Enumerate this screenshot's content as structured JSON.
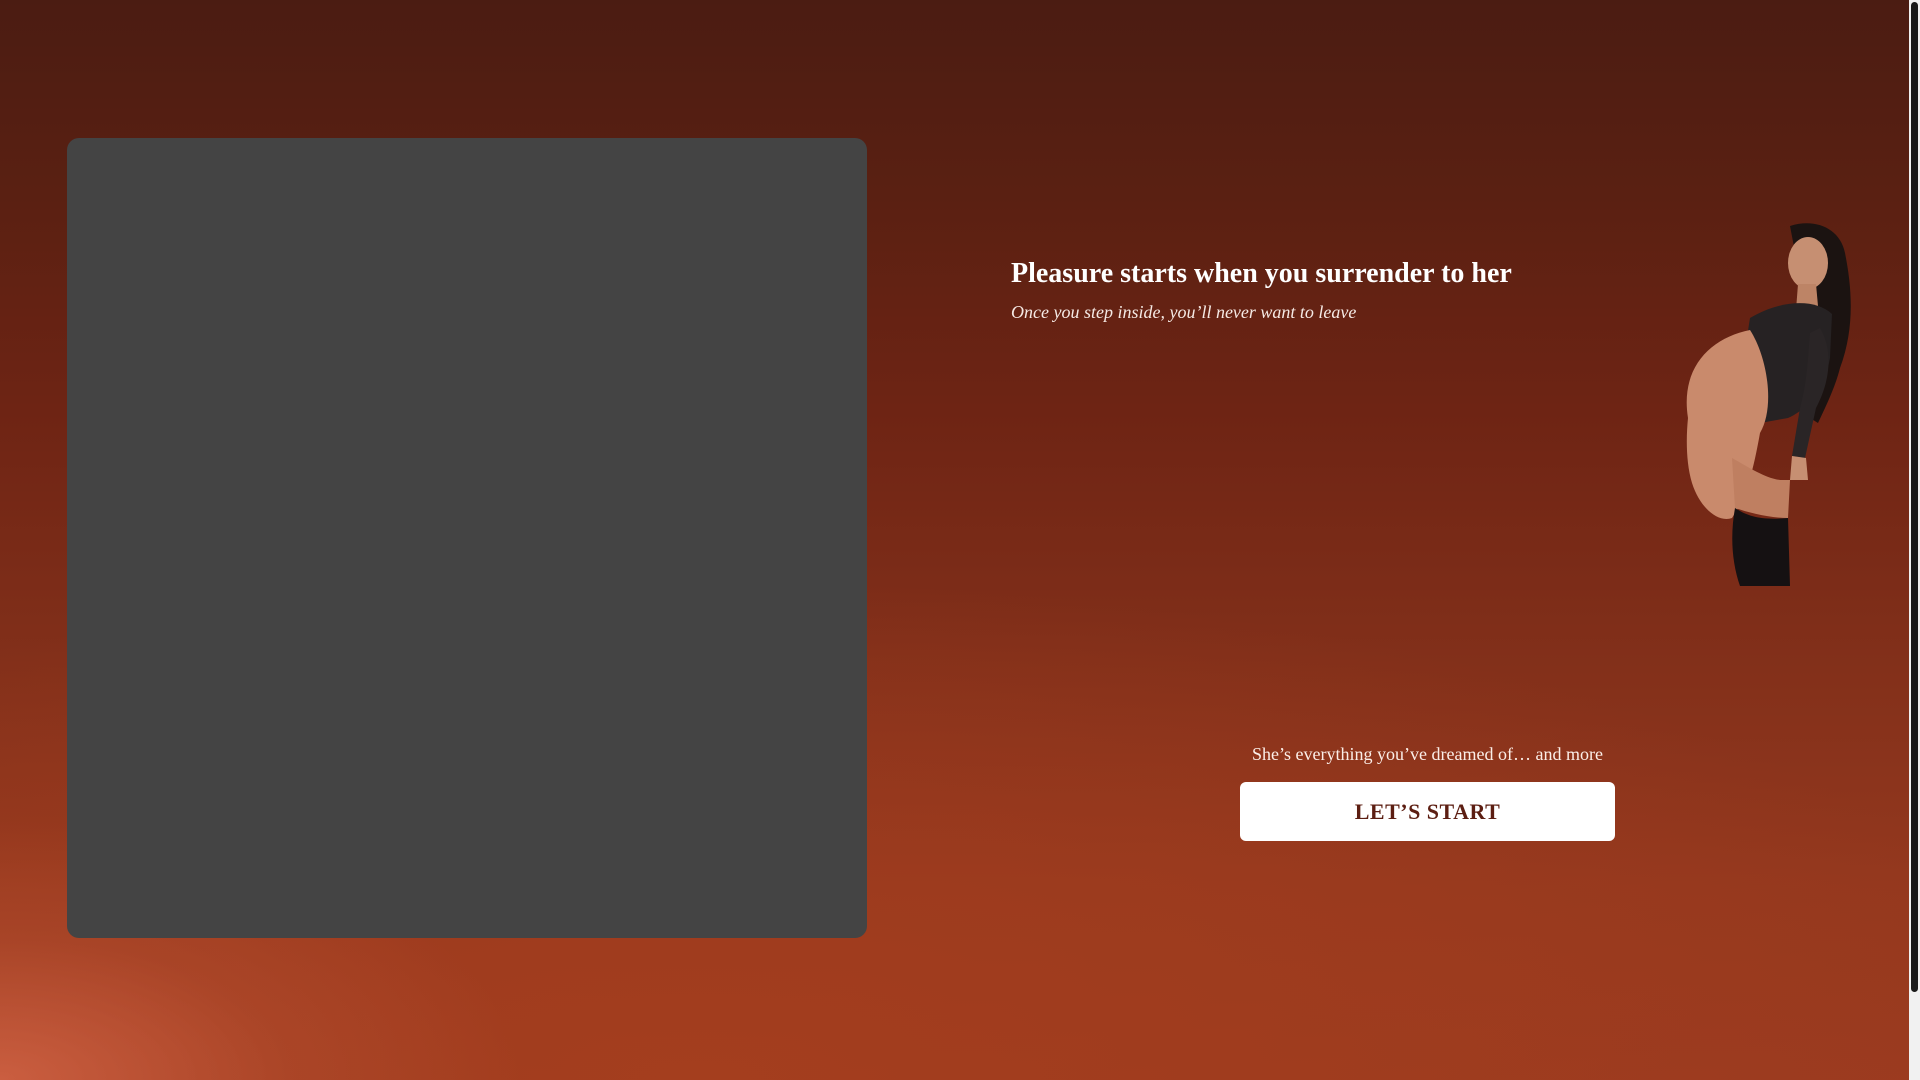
{
  "media_panel": {
    "color": "#444444"
  },
  "hero": {
    "headline": "Pleasure starts when you surrender to her",
    "subheadline": "Once you step inside, you’ll never want to leave"
  },
  "cta": {
    "tagline": "She’s everything you’ve dreamed of… and more",
    "button_label": "LET’S START"
  },
  "colors": {
    "background_top": "#4b1c12",
    "background_bottom": "#9a3a1f",
    "button_background": "#ffffff",
    "button_text": "#5c1e12"
  }
}
